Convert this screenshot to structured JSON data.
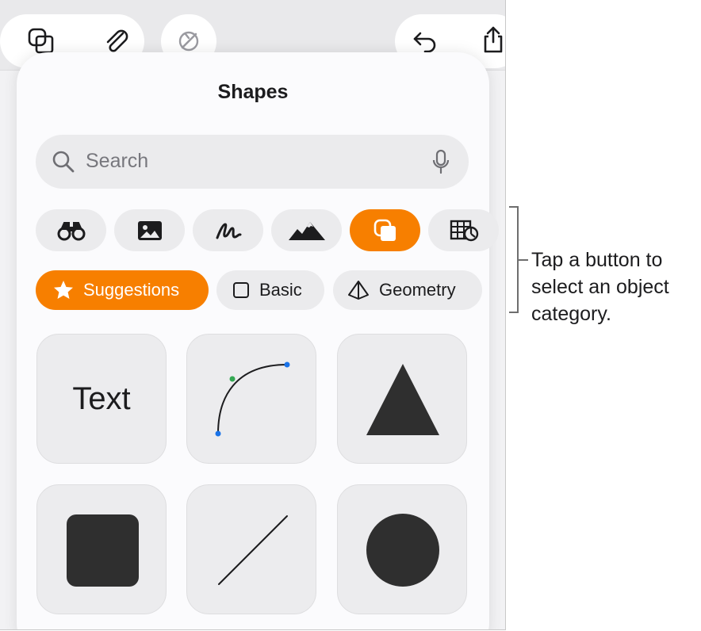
{
  "panel": {
    "title": "Shapes",
    "search": {
      "placeholder": "Search",
      "icon": "search-icon",
      "mic_icon": "microphone-icon"
    },
    "category_buttons": [
      {
        "icon": "binoculars-icon",
        "active": false
      },
      {
        "icon": "photo-icon",
        "active": false
      },
      {
        "icon": "drawing-icon",
        "active": false
      },
      {
        "icon": "mountains-icon",
        "active": false
      },
      {
        "icon": "shapes-icon",
        "active": true
      },
      {
        "icon": "table-chart-icon",
        "active": false
      }
    ],
    "chips": [
      {
        "label": "Suggestions",
        "icon": "star-icon",
        "active": true
      },
      {
        "label": "Basic",
        "icon": "square-outline-icon",
        "active": false
      },
      {
        "label": "Geometry",
        "icon": "pyramid-icon",
        "active": false
      }
    ],
    "tiles": [
      {
        "kind": "text",
        "label": "Text"
      },
      {
        "kind": "curve"
      },
      {
        "kind": "triangle"
      },
      {
        "kind": "square"
      },
      {
        "kind": "line"
      },
      {
        "kind": "circle"
      }
    ]
  },
  "callout": {
    "lines": [
      "Tap a button to",
      "select an object",
      "category."
    ]
  },
  "colors": {
    "accent": "#f77f00",
    "shape_fill": "#2f2f2f",
    "curve_end_point": "#1a73e8",
    "curve_control_point": "#34a853"
  }
}
